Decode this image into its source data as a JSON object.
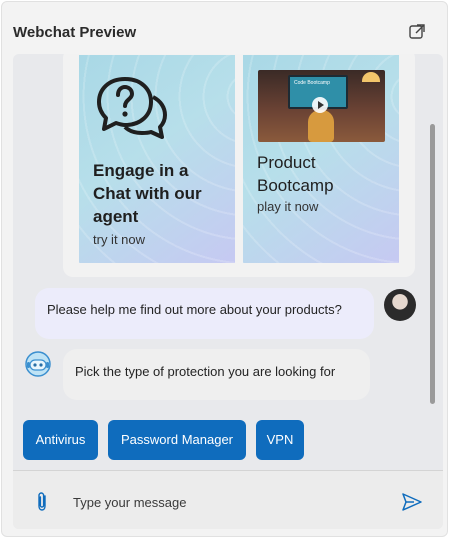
{
  "header": {
    "title": "Webchat Preview",
    "popout_icon": "popout-icon"
  },
  "carousel": {
    "cards": [
      {
        "title": "Engage in a Chat with our agent",
        "subtitle": "try it now",
        "icon": "chat-question-icon"
      },
      {
        "title": "Product Bootcamp",
        "subtitle": "play it now",
        "thumbnail_caption": "Code Bootcamp"
      }
    ]
  },
  "messages": {
    "user": "Please help me find out more about your products?",
    "bot": "Pick the type of protection you are looking for"
  },
  "actions": [
    "Antivirus",
    "Password Manager",
    "VPN"
  ],
  "composer": {
    "placeholder": "Type your message",
    "attach_icon": "paperclip-icon",
    "send_icon": "send-icon"
  },
  "colors": {
    "accent": "#0f6cbd",
    "user_bubble": "#ececfb",
    "bot_bubble": "#efefef",
    "chat_bg": "#e8e9ec"
  }
}
